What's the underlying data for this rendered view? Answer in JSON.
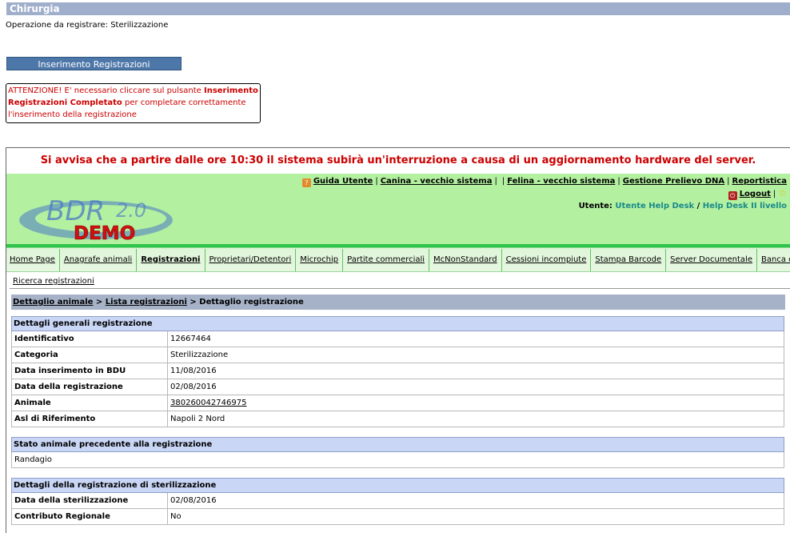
{
  "page_title": "Chirurgia",
  "operation_line": "Operazione da registrare: Sterilizzazione",
  "complete_button": "Inserimento Registrazioni Completato",
  "warning": {
    "part1": "ATTENZIONE! E' necessario cliccare sul pulsante ",
    "bold": "Inserimento Registrazioni Completato",
    "part2": " per completare correttamente l'inserimento della registrazione"
  },
  "notice": "Si avvisa che a partire dalle ore 10:30 il sistema subirà un'interruzione a causa di un aggiornamento hardware del server.",
  "logo": {
    "title": "BDR",
    "version": "2.0",
    "badge": "DEMO"
  },
  "top_links": {
    "guida": "Guida Utente",
    "canina": "Canina - vecchio sistema",
    "felina": "Felina - vecchio sistema",
    "prelievo": "Gestione Prelievo DNA",
    "reportistica": "Reportistica",
    "logout": "Logout"
  },
  "user": {
    "label": "Utente:",
    "name": "Utente Help Desk",
    "sep": "/",
    "role": "Help Desk II livello"
  },
  "nav": [
    "Home Page",
    "Anagrafe animali",
    "Registrazioni",
    "Proprietari/Detentori",
    "Microchip",
    "Partite commerciali",
    "McNonStandard",
    "Cessioni incompiute",
    "Stampa Barcode",
    "Server Documentale",
    "Banca dati Passaporti"
  ],
  "subnav": "Ricerca registrazioni",
  "breadcrumb": {
    "item1": "Dettaglio animale",
    "sep": ">",
    "item2": "Lista registrazioni",
    "current": "Dettaglio registrazione"
  },
  "general": {
    "header": "Dettagli generali registrazione",
    "rows": [
      {
        "label": "Identificativo",
        "value": "12667464"
      },
      {
        "label": "Categoria",
        "value": "Sterilizzazione"
      },
      {
        "label": "Data inserimento in BDU",
        "value": "11/08/2016"
      },
      {
        "label": "Data della registrazione",
        "value": "02/08/2016"
      },
      {
        "label": "Animale",
        "value": "380260042746975"
      },
      {
        "label": "Asl di Riferimento",
        "value": "Napoli 2 Nord"
      }
    ]
  },
  "previous_state": {
    "header": "Stato animale precedente alla registrazione",
    "value": "Randagio"
  },
  "sterilization": {
    "header": "Dettagli della registrazione di sterilizzazione",
    "rows": [
      {
        "label": "Data della sterilizzazione",
        "value": "02/08/2016"
      },
      {
        "label": "Contributo Regionale",
        "value": "No"
      }
    ]
  }
}
